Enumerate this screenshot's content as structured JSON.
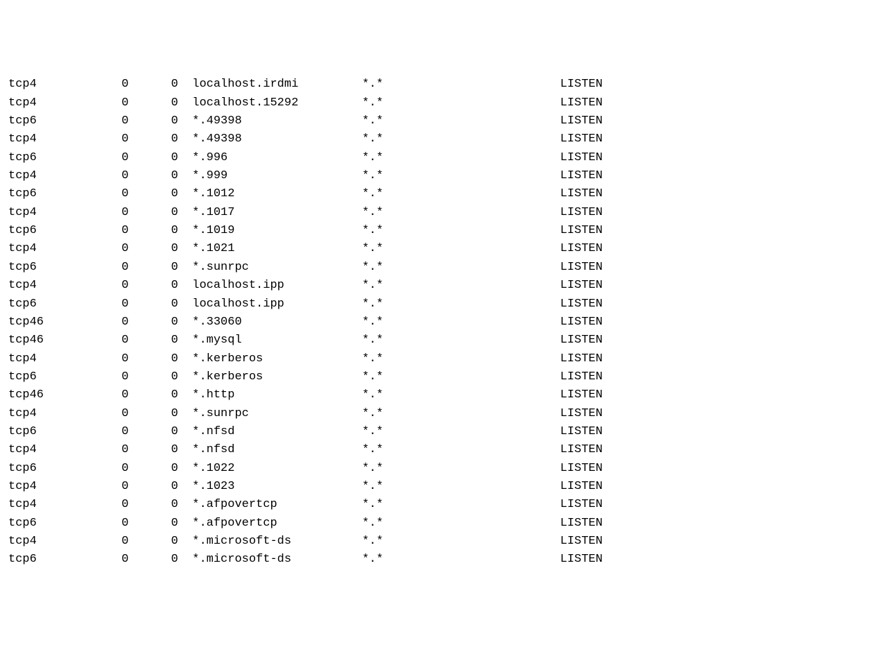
{
  "netstat": {
    "columns": {
      "proto_width": 10,
      "recvq_width": 7,
      "sendq_width": 7,
      "local_width": 24,
      "foreign_width": 28
    },
    "rows": [
      {
        "proto": "tcp4",
        "recvq": "0",
        "sendq": "0",
        "local": "localhost.irdmi",
        "foreign": "*.*",
        "state": "LISTEN"
      },
      {
        "proto": "tcp4",
        "recvq": "0",
        "sendq": "0",
        "local": "localhost.15292",
        "foreign": "*.*",
        "state": "LISTEN"
      },
      {
        "proto": "tcp6",
        "recvq": "0",
        "sendq": "0",
        "local": "*.49398",
        "foreign": "*.*",
        "state": "LISTEN"
      },
      {
        "proto": "tcp4",
        "recvq": "0",
        "sendq": "0",
        "local": "*.49398",
        "foreign": "*.*",
        "state": "LISTEN"
      },
      {
        "proto": "tcp6",
        "recvq": "0",
        "sendq": "0",
        "local": "*.996",
        "foreign": "*.*",
        "state": "LISTEN"
      },
      {
        "proto": "tcp4",
        "recvq": "0",
        "sendq": "0",
        "local": "*.999",
        "foreign": "*.*",
        "state": "LISTEN"
      },
      {
        "proto": "tcp6",
        "recvq": "0",
        "sendq": "0",
        "local": "*.1012",
        "foreign": "*.*",
        "state": "LISTEN"
      },
      {
        "proto": "tcp4",
        "recvq": "0",
        "sendq": "0",
        "local": "*.1017",
        "foreign": "*.*",
        "state": "LISTEN"
      },
      {
        "proto": "tcp6",
        "recvq": "0",
        "sendq": "0",
        "local": "*.1019",
        "foreign": "*.*",
        "state": "LISTEN"
      },
      {
        "proto": "tcp4",
        "recvq": "0",
        "sendq": "0",
        "local": "*.1021",
        "foreign": "*.*",
        "state": "LISTEN"
      },
      {
        "proto": "tcp6",
        "recvq": "0",
        "sendq": "0",
        "local": "*.sunrpc",
        "foreign": "*.*",
        "state": "LISTEN"
      },
      {
        "proto": "tcp4",
        "recvq": "0",
        "sendq": "0",
        "local": "localhost.ipp",
        "foreign": "*.*",
        "state": "LISTEN"
      },
      {
        "proto": "tcp6",
        "recvq": "0",
        "sendq": "0",
        "local": "localhost.ipp",
        "foreign": "*.*",
        "state": "LISTEN"
      },
      {
        "proto": "tcp46",
        "recvq": "0",
        "sendq": "0",
        "local": "*.33060",
        "foreign": "*.*",
        "state": "LISTEN"
      },
      {
        "proto": "tcp46",
        "recvq": "0",
        "sendq": "0",
        "local": "*.mysql",
        "foreign": "*.*",
        "state": "LISTEN"
      },
      {
        "proto": "tcp4",
        "recvq": "0",
        "sendq": "0",
        "local": "*.kerberos",
        "foreign": "*.*",
        "state": "LISTEN"
      },
      {
        "proto": "tcp6",
        "recvq": "0",
        "sendq": "0",
        "local": "*.kerberos",
        "foreign": "*.*",
        "state": "LISTEN"
      },
      {
        "proto": "tcp46",
        "recvq": "0",
        "sendq": "0",
        "local": "*.http",
        "foreign": "*.*",
        "state": "LISTEN"
      },
      {
        "proto": "tcp4",
        "recvq": "0",
        "sendq": "0",
        "local": "*.sunrpc",
        "foreign": "*.*",
        "state": "LISTEN"
      },
      {
        "proto": "tcp6",
        "recvq": "0",
        "sendq": "0",
        "local": "*.nfsd",
        "foreign": "*.*",
        "state": "LISTEN"
      },
      {
        "proto": "tcp4",
        "recvq": "0",
        "sendq": "0",
        "local": "*.nfsd",
        "foreign": "*.*",
        "state": "LISTEN"
      },
      {
        "proto": "tcp6",
        "recvq": "0",
        "sendq": "0",
        "local": "*.1022",
        "foreign": "*.*",
        "state": "LISTEN"
      },
      {
        "proto": "tcp4",
        "recvq": "0",
        "sendq": "0",
        "local": "*.1023",
        "foreign": "*.*",
        "state": "LISTEN"
      },
      {
        "proto": "tcp4",
        "recvq": "0",
        "sendq": "0",
        "local": "*.afpovertcp",
        "foreign": "*.*",
        "state": "LISTEN"
      },
      {
        "proto": "tcp6",
        "recvq": "0",
        "sendq": "0",
        "local": "*.afpovertcp",
        "foreign": "*.*",
        "state": "LISTEN"
      },
      {
        "proto": "tcp4",
        "recvq": "0",
        "sendq": "0",
        "local": "*.microsoft-ds",
        "foreign": "*.*",
        "state": "LISTEN"
      },
      {
        "proto": "tcp6",
        "recvq": "0",
        "sendq": "0",
        "local": "*.microsoft-ds",
        "foreign": "*.*",
        "state": "LISTEN"
      }
    ]
  }
}
